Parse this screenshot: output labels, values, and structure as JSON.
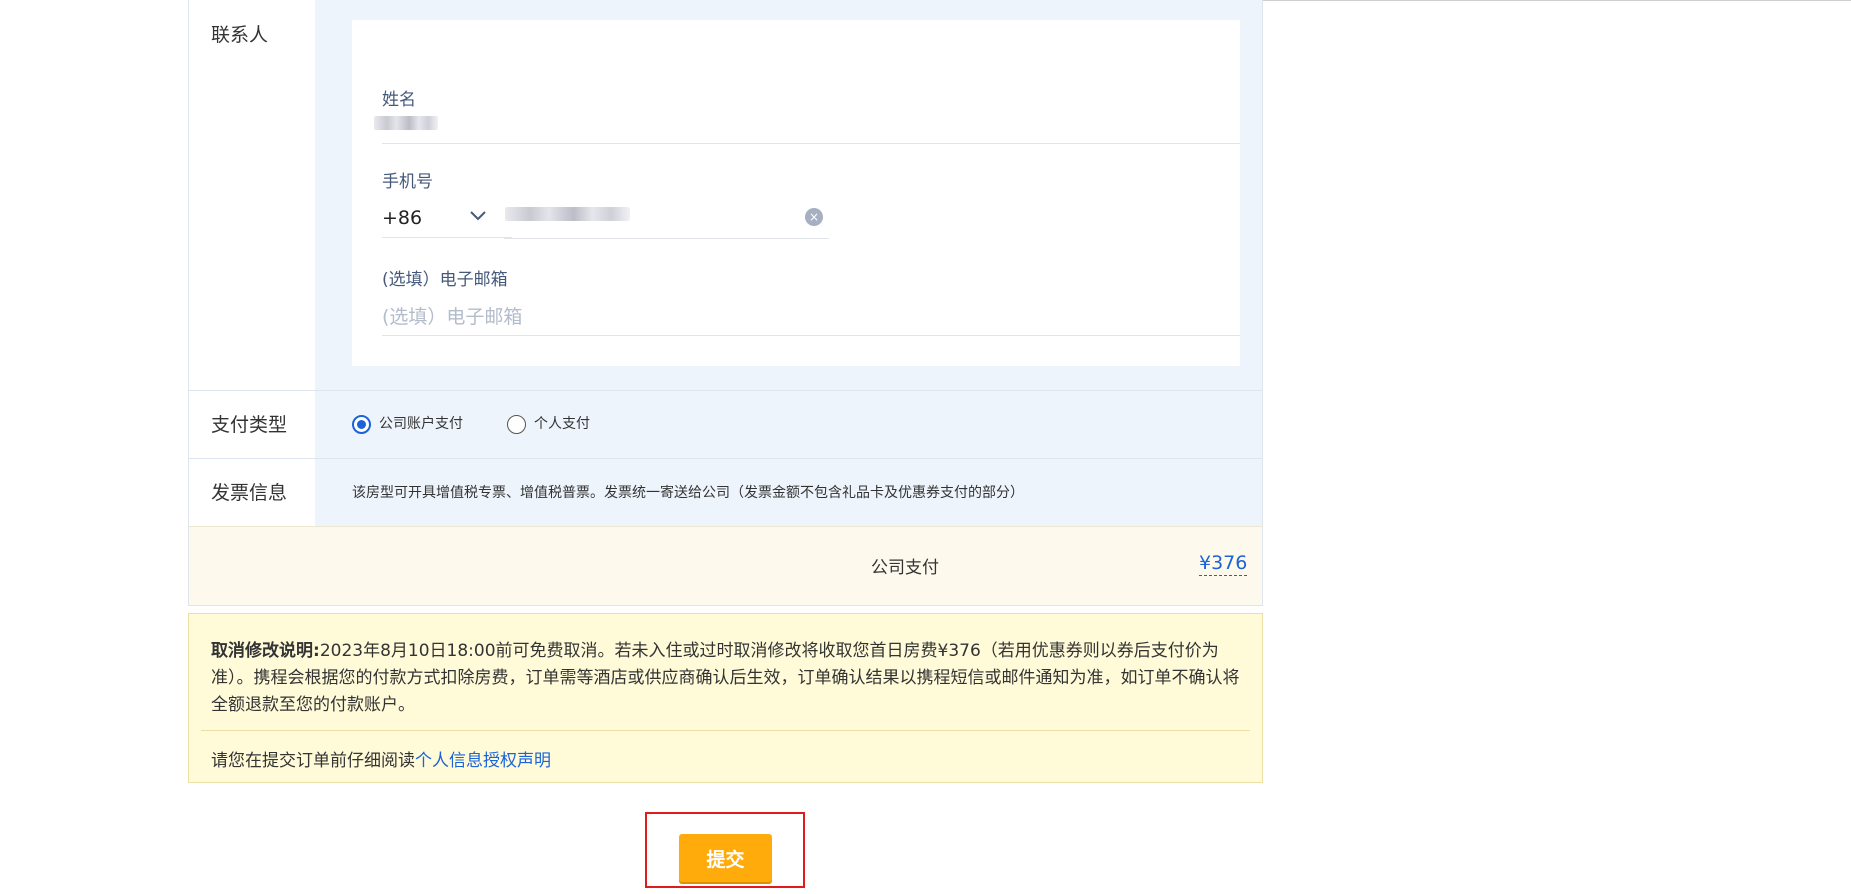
{
  "contact": {
    "section_label": "联系人",
    "name_label": "姓名",
    "phone_label": "手机号",
    "country_code": "+86",
    "email_label": "(选填）电子邮箱",
    "email_placeholder": "(选填）电子邮箱",
    "clear_glyph": "×"
  },
  "payment_type": {
    "section_label": "支付类型",
    "options": [
      {
        "label": "公司账户支付",
        "selected": true
      },
      {
        "label": "个人支付",
        "selected": false
      }
    ]
  },
  "invoice": {
    "section_label": "发票信息",
    "text": "该房型可开具增值税专票、增值税普票。发票统一寄送给公司（发票金额不包含礼品卡及优惠券支付的部分）"
  },
  "payment_summary": {
    "label": "公司支付",
    "amount": "¥376"
  },
  "cancellation": {
    "title": "取消修改说明:",
    "body": "2023年8月10日18:00前可免费取消。若未入住或过时取消修改将收取您首日房费¥376（若用优惠券则以券后支付价为准）。携程会根据您的付款方式扣除房费，订单需等酒店或供应商确认后生效，订单确认结果以携程短信或邮件通知为准，如订单不确认将全额退款至您的付款账户。",
    "read_prefix": "请您在提交订单前仔细阅读",
    "read_link": "个人信息授权声明"
  },
  "submit": {
    "label": "提交"
  },
  "colors": {
    "accent": "#1a63d8",
    "submit": "#ffab0c",
    "highlight_frame": "#e01b1b"
  }
}
